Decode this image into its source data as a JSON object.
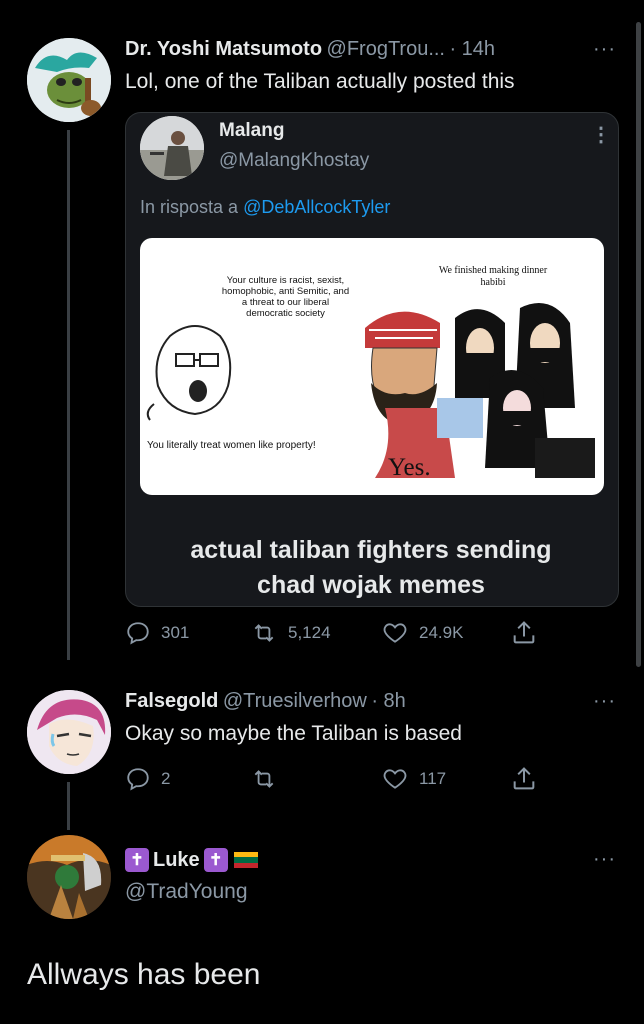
{
  "tweet1": {
    "display_name": "Dr. Yoshi Matsumoto",
    "handle": "@FrogTrou...",
    "time": "· 14h",
    "text": "Lol, one of the Taliban actually posted this",
    "more": "···"
  },
  "quoted": {
    "display_name": "Malang",
    "handle": "@MalangKhostay",
    "reply_prefix": "In risposta a",
    "reply_to": "@DebAllcockTyler",
    "more": "⋮",
    "caption_line1": "actual taliban fighters sending",
    "caption_line2": "chad wojak memes",
    "meme": {
      "left_text_1": "Your culture is racist, sexist,",
      "left_text_2": "homophobic, anti Semitic, and",
      "left_text_3": "a threat to our liberal",
      "left_text_4": "democratic society",
      "bottom_text": "You literally treat women like property!",
      "right_text_1": "We finished making dinner",
      "right_text_2": "habibi",
      "yes_text": "Yes."
    }
  },
  "tweet1_actions": {
    "replies": "301",
    "retweets": "5,124",
    "likes": "24.9K"
  },
  "tweet2": {
    "display_name": "Falsegold",
    "handle": "@Truesilverhow",
    "time": "· 8h",
    "text": "Okay so maybe the Taliban is based",
    "more": "···",
    "replies": "2",
    "likes": "117"
  },
  "tweet3": {
    "cross_left": "✝",
    "display_name": "Luke",
    "cross_right": "✝",
    "handle": "@TradYoung",
    "text": "Allways has been",
    "more": "···"
  },
  "colors": {
    "background": "#000000",
    "text": "#e7e9ea",
    "muted": "#8b98a5",
    "link": "#1d9bf0",
    "cross_purple": "#9b59d0"
  }
}
